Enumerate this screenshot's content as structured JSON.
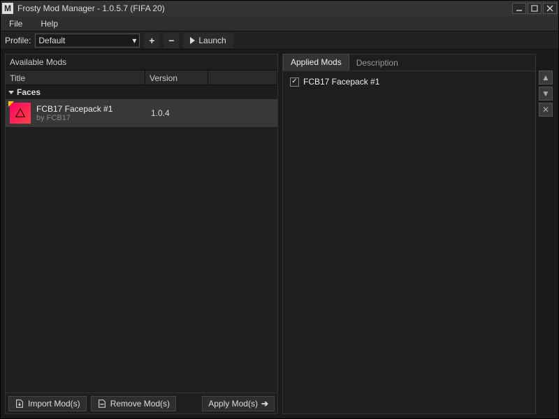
{
  "window": {
    "title": "Frosty Mod Manager - 1.0.5.7 (FIFA 20)",
    "logo": "M"
  },
  "menu": {
    "file": "File",
    "help": "Help"
  },
  "toolbar": {
    "profile_label": "Profile:",
    "profile_value": "Default",
    "launch_label": "Launch"
  },
  "left": {
    "title": "Available Mods",
    "columns": {
      "title": "Title",
      "version": "Version"
    },
    "category": "Faces",
    "mod": {
      "name": "FCB17 Facepack #1",
      "author": "by FCB17",
      "version": "1.0.4"
    }
  },
  "right": {
    "tabs": {
      "applied": "Applied Mods",
      "description": "Description"
    },
    "applied_item": "FCB17 Facepack #1",
    "applied_checked": true
  },
  "bottom": {
    "import": "Import Mod(s)",
    "remove": "Remove Mod(s)",
    "apply": "Apply Mod(s)"
  }
}
